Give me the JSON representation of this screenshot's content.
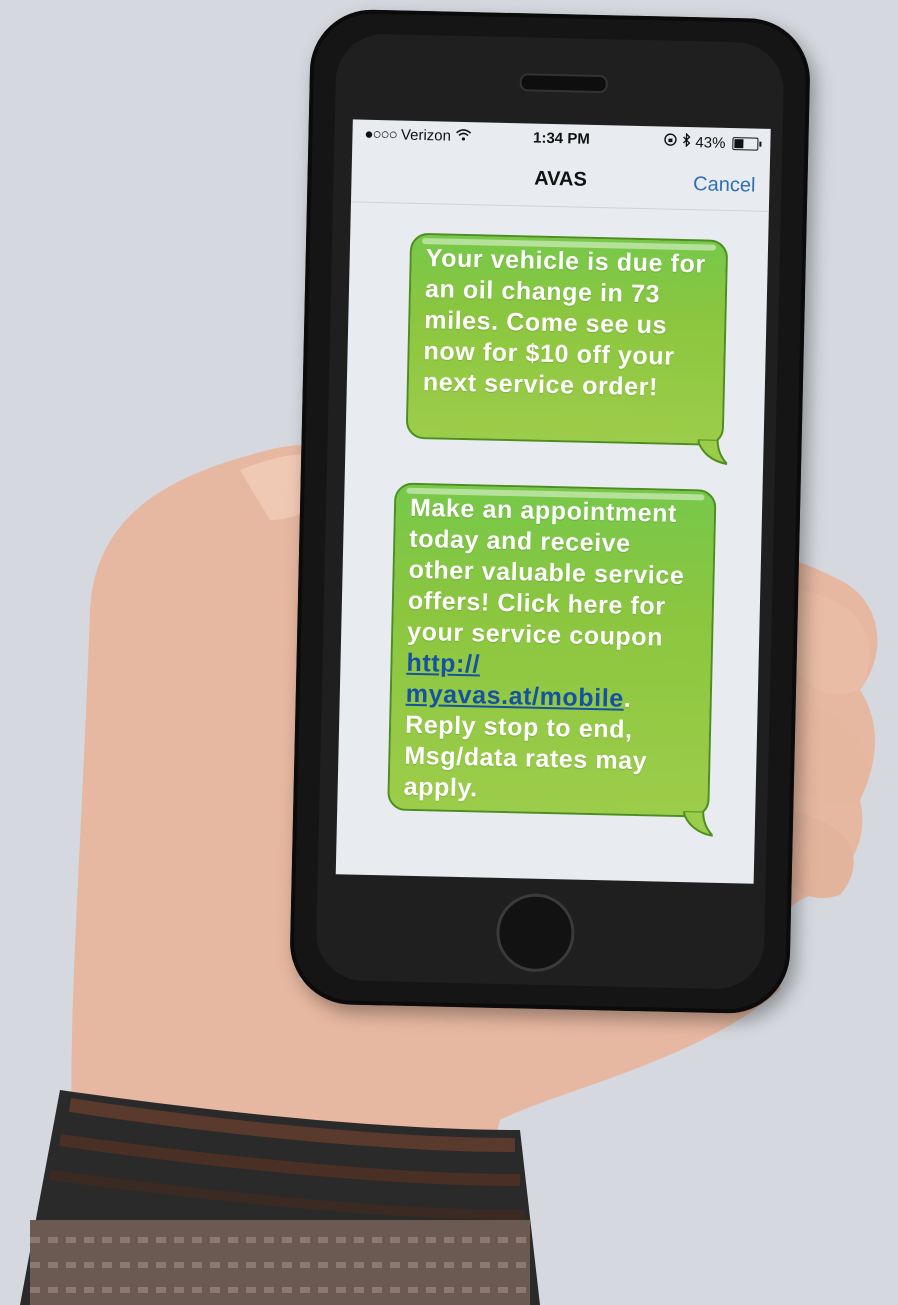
{
  "status_bar": {
    "signal": "●○○○",
    "carrier": "Verizon",
    "time": "1:34 PM",
    "battery_percent": "43%",
    "battery_level": 0.43
  },
  "nav": {
    "title": "AVAS",
    "cancel_label": "Cancel"
  },
  "messages": [
    {
      "text": "Your vehicle is due for an oil change in 73 miles. Come see us now for $10 off your next service order!"
    },
    {
      "text_before_link": "Make an appointment today and receive other valuable service offers! Click here for your service coupon ",
      "link_text": "http:// myavas.at/mobile",
      "text_after_link": ". Reply stop to end, Msg/data rates may apply."
    }
  ],
  "colors": {
    "bubble_green": "#8cc63f",
    "link_blue": "#1552a3",
    "cancel_blue": "#2f6fb3",
    "background": "#d5d9df"
  }
}
